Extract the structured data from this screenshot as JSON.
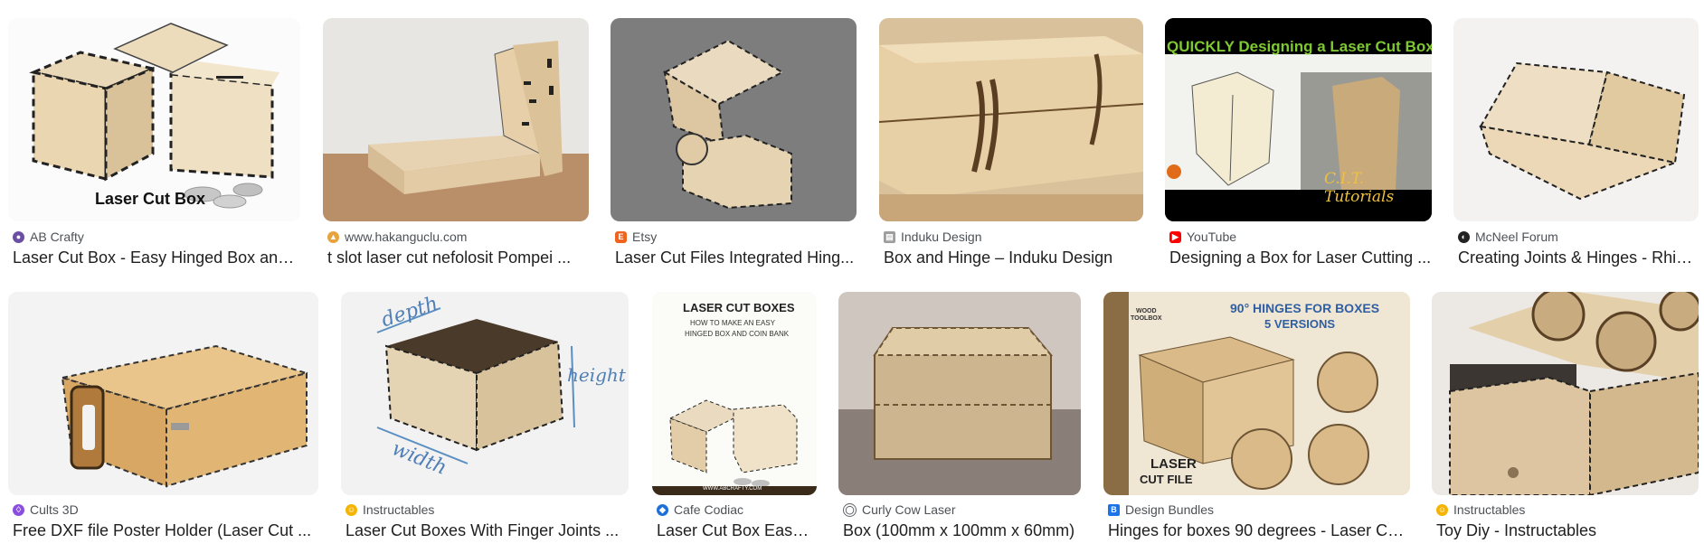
{
  "results": [
    {
      "source": "AB Crafty",
      "title": "Laser Cut Box - Easy Hinged Box and ...",
      "caption": "Laser Cut Box",
      "fav_icon": "ab-crafty-icon",
      "fav_color": "#6b4fa2"
    },
    {
      "source": "www.hakanguclu.com",
      "title": "t slot laser cut nefolosit Pompei ...",
      "fav_icon": "hakanguclu-icon",
      "fav_color": "#e8a33c"
    },
    {
      "source": "Etsy",
      "title": "Laser Cut Files Integrated Hing...",
      "fav_icon": "etsy-icon",
      "fav_color": "#f1641e"
    },
    {
      "source": "Induku Design",
      "title": "Box and Hinge – Induku Design",
      "fav_icon": "induku-icon",
      "fav_color": "#9e9e9e"
    },
    {
      "source": "YouTube",
      "title": "Designing a Box for Laser Cutting ...",
      "video_title": "QUICKLY Designing a Laser Cut Box!",
      "video_caption": "C.I.T. Tutorials",
      "fav_icon": "youtube-icon",
      "fav_color": "#ff0000"
    },
    {
      "source": "McNeel Forum",
      "title": "Creating Joints & Hinges - Rhin...",
      "fav_icon": "mcneel-icon",
      "fav_color": "#222222"
    },
    {
      "source": "Cults 3D",
      "title": "Free DXF file Poster Holder (Laser Cut ...",
      "fav_icon": "cults3d-icon",
      "fav_color": "#8a4de0"
    },
    {
      "source": "Instructables",
      "title": "Laser Cut Boxes With Finger Joints ...",
      "labels": [
        "depth",
        "height",
        "width"
      ],
      "fav_icon": "instructables-icon",
      "fav_color": "#f4b400"
    },
    {
      "source": "Cafe Codiac",
      "title": "Laser Cut Box Easy ...",
      "poster_lines": [
        "LASER CUT BOXES",
        "HOW TO MAKE AN EASY",
        "HINGED BOX AND COIN BANK",
        "WWW.ABCRAFTY.COM"
      ],
      "fav_icon": "cafe-codiac-icon",
      "fav_color": "#1e6fd9"
    },
    {
      "source": "Curly Cow Laser",
      "title": "Box (100mm x 100mm x 60mm)",
      "fav_icon": "globe-icon",
      "fav_color": "#5f6368"
    },
    {
      "source": "Design Bundles",
      "title": "Hinges for boxes 90 degrees - Laser Cu...",
      "poster_lines": [
        "90° HINGES FOR BOXES",
        "5 VERSIONS",
        "WOOD",
        "TOOLBOX",
        "LASER",
        "CUT FILE"
      ],
      "fav_icon": "design-bundles-icon",
      "fav_color": "#1a73e8"
    },
    {
      "source": "Instructables",
      "title": "Toy Diy - Instructables",
      "fav_icon": "instructables-icon",
      "fav_color": "#f4b400"
    }
  ]
}
